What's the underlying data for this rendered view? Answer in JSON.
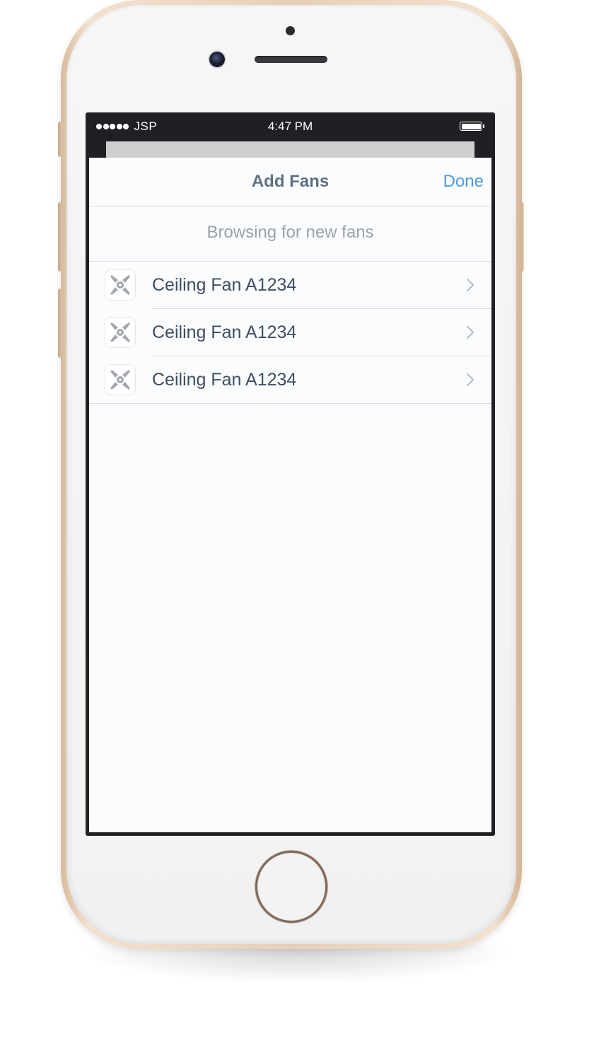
{
  "status_bar": {
    "signal_bars": 5,
    "carrier": "JSP",
    "time": "4:47 PM",
    "battery_level": 1.0
  },
  "nav": {
    "title": "Add Fans",
    "done_label": "Done"
  },
  "section_header": "Browsing for new fans",
  "fans": [
    {
      "label": "Ceiling Fan A1234",
      "icon": "fan-icon"
    },
    {
      "label": "Ceiling Fan A1234",
      "icon": "fan-icon"
    },
    {
      "label": "Ceiling Fan A1234",
      "icon": "fan-icon"
    }
  ],
  "colors": {
    "accent": "#4b9ce0",
    "title": "#5f7084",
    "row_text": "#3e4d62",
    "subtle_text": "#9aa2ab",
    "icon_gray": "#a2a8b0",
    "phone_gold": "#e7cfb6"
  },
  "device": {
    "model": "iphone-gold-white"
  }
}
